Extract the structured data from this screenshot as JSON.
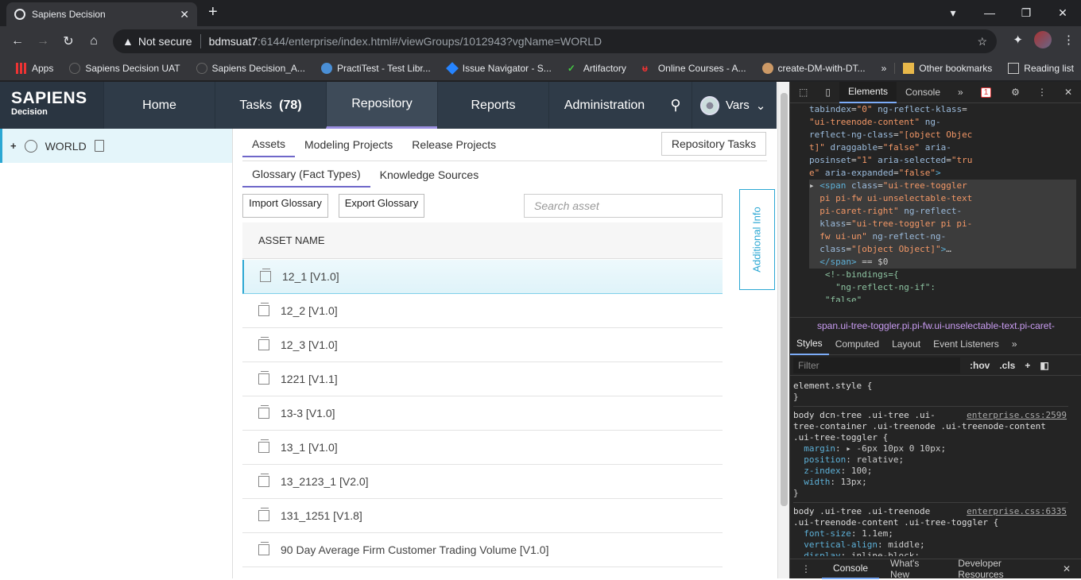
{
  "browser": {
    "tab_title": "Sapiens Decision",
    "not_secure": "Not secure",
    "url_host": "bdmsuat7",
    "url_path": ":6144/enterprise/index.html#/viewGroups/1012943?vgName=WORLD",
    "bookmarks": [
      "Apps",
      "Sapiens Decision UAT",
      "Sapiens Decision_A...",
      "PractiTest - Test Libr...",
      "Issue Navigator - S...",
      "Artifactory",
      "Online Courses - A...",
      "create-DM-with-DT...",
      "»",
      "Other bookmarks",
      "Reading list"
    ]
  },
  "app": {
    "logo_line1": "SAPIENS",
    "logo_line2": "Decision",
    "nav": [
      "Home",
      "Tasks",
      "Repository",
      "Reports",
      "Administration"
    ],
    "tasks_count": "(78)",
    "user": "Vars"
  },
  "tree": {
    "root_label": "WORLD"
  },
  "main": {
    "tabs1": [
      "Assets",
      "Modeling Projects",
      "Release Projects"
    ],
    "repository_tasks": "Repository Tasks",
    "tabs2": [
      "Glossary (Fact Types)",
      "Knowledge Sources"
    ],
    "import_btn": "Import Glossary",
    "export_btn": "Export Glossary",
    "search_placeholder": "Search asset",
    "column_header": "ASSET NAME",
    "rows": [
      "12_1 [V1.0]",
      "12_2 [V1.0]",
      "12_3 [V1.0]",
      "1221 [V1.1]",
      "13-3 [V1.0]",
      "13_1 [V1.0]",
      "13_2123_1 [V2.0]",
      "131_1251 [V1.8]",
      "90 Day Average Firm Customer Trading Volume [V1.0]"
    ],
    "additional_info": "Additional Info"
  },
  "devtools": {
    "tabs": [
      "Elements",
      "Console",
      "»"
    ],
    "error_count": "1",
    "breadcrumb": "span.ui-tree-toggler.pi.pi-fw.ui-unselectable-text.pi-caret-",
    "style_tabs": [
      "Styles",
      "Computed",
      "Layout",
      "Event Listeners",
      "»"
    ],
    "filter_placeholder": "Filter",
    "hov": ":hov",
    "cls": ".cls",
    "drawer_tabs": [
      "Console",
      "What's New",
      "Developer Resources"
    ]
  }
}
